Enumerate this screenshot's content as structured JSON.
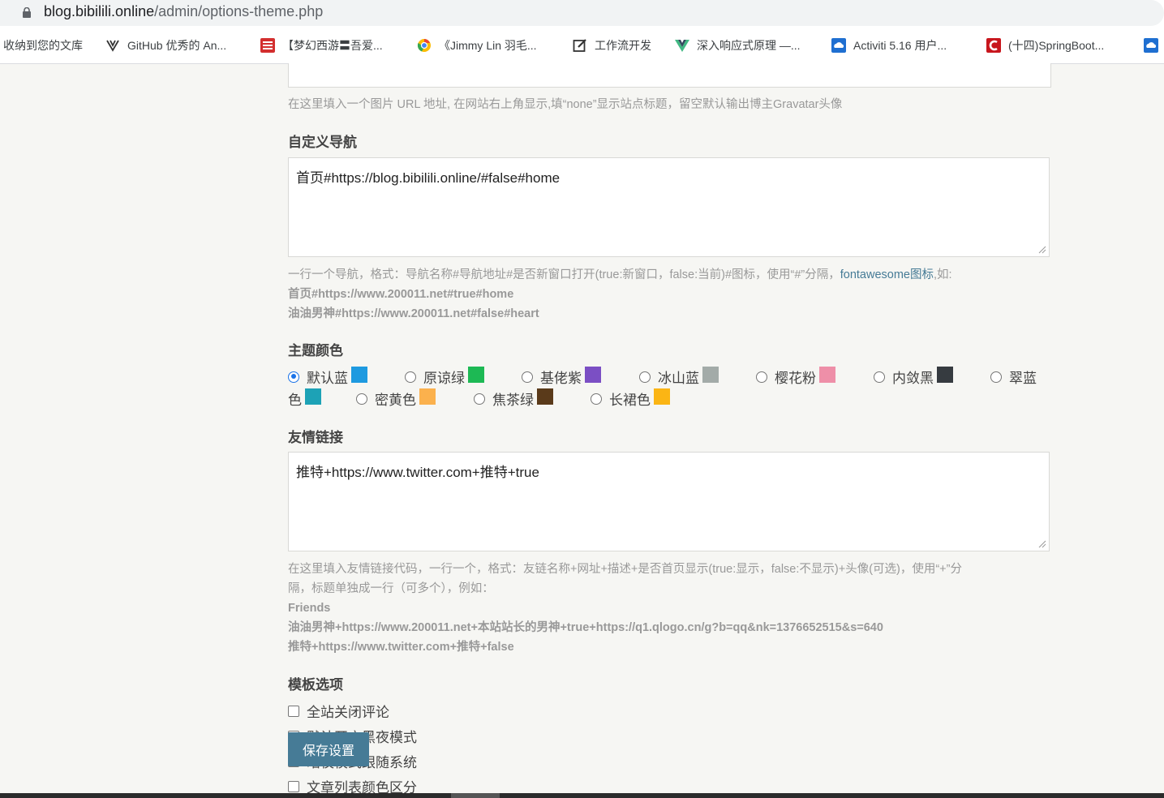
{
  "browser": {
    "url_host": "blog.bibilili.online",
    "url_path": "/admin/options-theme.php"
  },
  "bookmarks": [
    {
      "label": "收纳到您的文库",
      "icon": "none"
    },
    {
      "label": "GitHub 优秀的 An...",
      "icon": "github-icon"
    },
    {
      "label": "【梦幻西游〓吾爱...",
      "icon": "forum-icon"
    },
    {
      "label": "《Jimmy Lin 羽毛...",
      "icon": "chrome-icon"
    },
    {
      "label": "工作流开发",
      "icon": "edit-icon"
    },
    {
      "label": "深入响应式原理 —...",
      "icon": "vue-icon"
    },
    {
      "label": "Activiti 5.16 用户...",
      "icon": "cloud-icon"
    },
    {
      "label": "(十四)SpringBoot...",
      "icon": "csdn-icon"
    },
    {
      "label": "",
      "icon": "cloud-icon"
    }
  ],
  "logo_field": {
    "value": "",
    "help": "在这里填入一个图片 URL 地址, 在网站右上角显示,填“none”显示站点标题，留空默认输出博主Gravatar头像"
  },
  "nav_field": {
    "label": "自定义导航",
    "value": "首页#https://blog.bibilili.online/#false#home",
    "help_prefix": "一行一个导航，格式：导航名称#导航地址#是否新窗口打开(true:新窗口，false:当前)#图标，使用“#”分隔，",
    "help_link": "fontawesome图标",
    "help_suffix": ",如:",
    "example1": "首页#https://www.200011.net#true#home",
    "example2": "油油男神#https://www.200011.net#false#heart"
  },
  "theme_color": {
    "label": "主题颜色",
    "options": [
      {
        "label": "默认蓝",
        "color": "#1e9ae0",
        "checked": true
      },
      {
        "label": "原谅绿",
        "color": "#1db954",
        "checked": false
      },
      {
        "label": "基佬紫",
        "color": "#7b4fc4",
        "checked": false
      },
      {
        "label": "冰山蓝",
        "color": "#a3aba8",
        "checked": false
      },
      {
        "label": "樱花粉",
        "color": "#ee8fa8",
        "checked": false
      },
      {
        "label": "内敛黑",
        "color": "#363b40",
        "checked": false
      },
      {
        "label": "翠蓝",
        "color": "#1da2b6",
        "checked": false
      },
      {
        "label": "色",
        "color": "#1da2b6",
        "checked": false
      },
      {
        "label": "密黄色",
        "color": "#fbb14d",
        "checked": false
      },
      {
        "label": "焦茶绿",
        "color": "#5a3a1a",
        "checked": false
      },
      {
        "label": "长裙色",
        "color": "#fbb514",
        "checked": false
      }
    ]
  },
  "links_field": {
    "label": "友情链接",
    "value": "推特+https://www.twitter.com+推特+true",
    "help_line1": "在这里填入友情链接代码，一行一个，格式：友链名称+网址+描述+是否首页显示(true:显示，false:不显示)+头像(可选)，使用“+”分",
    "help_line2": "隔，标题单独成一行（可多个），例如：",
    "example1": "Friends",
    "example2": "油油男神+https://www.200011.net+本站站长的男神+true+https://q1.qlogo.cn/g?b=qq&nk=1376652515&s=640",
    "example3": "推特+https://www.twitter.com+推特+false"
  },
  "template_options": {
    "label": "模板选项",
    "items": [
      {
        "label": "全站关闭评论",
        "checked": false
      },
      {
        "label": "默认开启黑夜模式",
        "checked": false
      },
      {
        "label": "暗夜模式跟随系统",
        "checked": false
      },
      {
        "label": "文章列表颜色区分",
        "checked": false
      }
    ]
  },
  "save_button": "保存设置"
}
